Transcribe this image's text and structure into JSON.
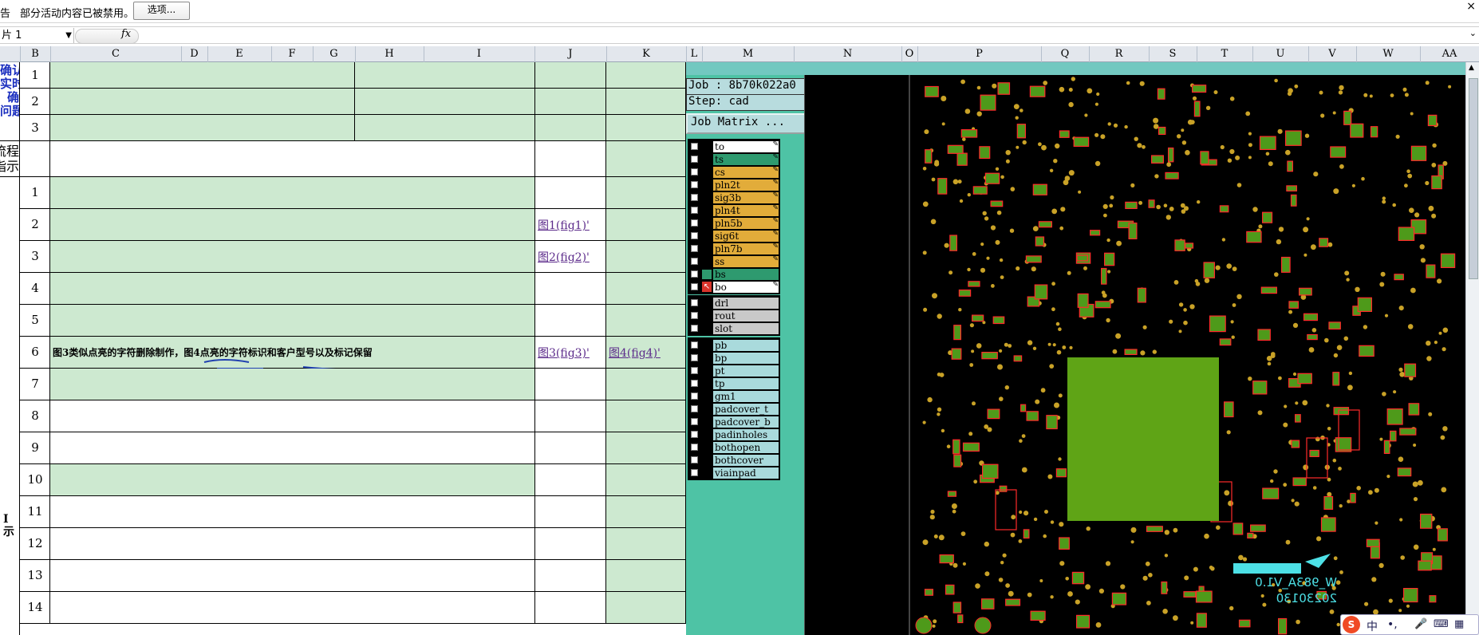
{
  "message_bar": {
    "warning_prefix": "告",
    "message": "部分活动内容已被禁用。",
    "options_button": "选项...",
    "close_glyph": "×"
  },
  "formula_bar": {
    "name_box": "片 1",
    "fx": "fx"
  },
  "columns": [
    "B",
    "C",
    "D",
    "E",
    "F",
    "G",
    "H",
    "I",
    "J",
    "K",
    "L",
    "M",
    "N",
    "O",
    "P",
    "Q",
    "R",
    "S",
    "T",
    "U",
    "V",
    "W",
    "AA"
  ],
  "sheet": {
    "section_a_title": "确认\n实时\n确\n问题",
    "section_b_title": "艺流程\n指示",
    "section_c_title": "I\n示",
    "top_rows": [
      "1",
      "2",
      "3"
    ],
    "rows": [
      "1",
      "2",
      "3",
      "4",
      "5",
      "6",
      "7",
      "8",
      "9",
      "10",
      "11",
      "12",
      "13",
      "14"
    ],
    "row6_text": "图3类似点亮的字符删除制作，图4点亮的字符标识和客户型号以及标记保留",
    "links": {
      "fig1": "图1(fig1)'",
      "fig2": "图2(fig2)'",
      "fig3": "图3(fig3)'",
      "fig4": "图4(fig4)'"
    }
  },
  "cam": {
    "job": "Job : 8b70k022a0",
    "step": "Step: cad",
    "job_matrix": "Job Matrix ...",
    "layers_group1": [
      {
        "name": "to",
        "color": "#ffffff"
      },
      {
        "name": "ts",
        "color": "#2e9a6f"
      },
      {
        "name": "cs",
        "color": "#e2ac3a"
      },
      {
        "name": "pln2t",
        "color": "#e2ac3a"
      },
      {
        "name": "sig3b",
        "color": "#e2ac3a"
      },
      {
        "name": "pln4t",
        "color": "#e2ac3a"
      },
      {
        "name": "pln5b",
        "color": "#e2ac3a"
      },
      {
        "name": "sig6t",
        "color": "#e2ac3a"
      },
      {
        "name": "pln7b",
        "color": "#e2ac3a"
      },
      {
        "name": "ss",
        "color": "#e2ac3a"
      },
      {
        "name": "bs",
        "color": "#2e9a6f"
      },
      {
        "name": "bo",
        "color": "#ffffff"
      }
    ],
    "layers_group2": [
      {
        "name": "drl",
        "color": "#c9c9c9"
      },
      {
        "name": "rout",
        "color": "#c9c9c9"
      },
      {
        "name": "slot",
        "color": "#c9c9c9"
      }
    ],
    "layers_group3": [
      {
        "name": "pb",
        "color": "#a9dadc"
      },
      {
        "name": "bp",
        "color": "#a9dadc"
      },
      {
        "name": "pt",
        "color": "#a9dadc"
      },
      {
        "name": "tp",
        "color": "#a9dadc"
      },
      {
        "name": "gm1",
        "color": "#a9dadc"
      },
      {
        "name": "padcover_t",
        "color": "#a9dadc"
      },
      {
        "name": "padcover_b",
        "color": "#a9dadc"
      },
      {
        "name": "padinholes",
        "color": "#a9dadc"
      },
      {
        "name": "bothopen",
        "color": "#a9dadc"
      },
      {
        "name": "bothcover",
        "color": "#a9dadc"
      },
      {
        "name": "viainpad",
        "color": "#a9dadc"
      }
    ],
    "pcb_text_line1": "W_983A_V1.0",
    "pcb_text_line2": "20230130"
  },
  "ime": {
    "lang": "中",
    "punct": "•,"
  }
}
